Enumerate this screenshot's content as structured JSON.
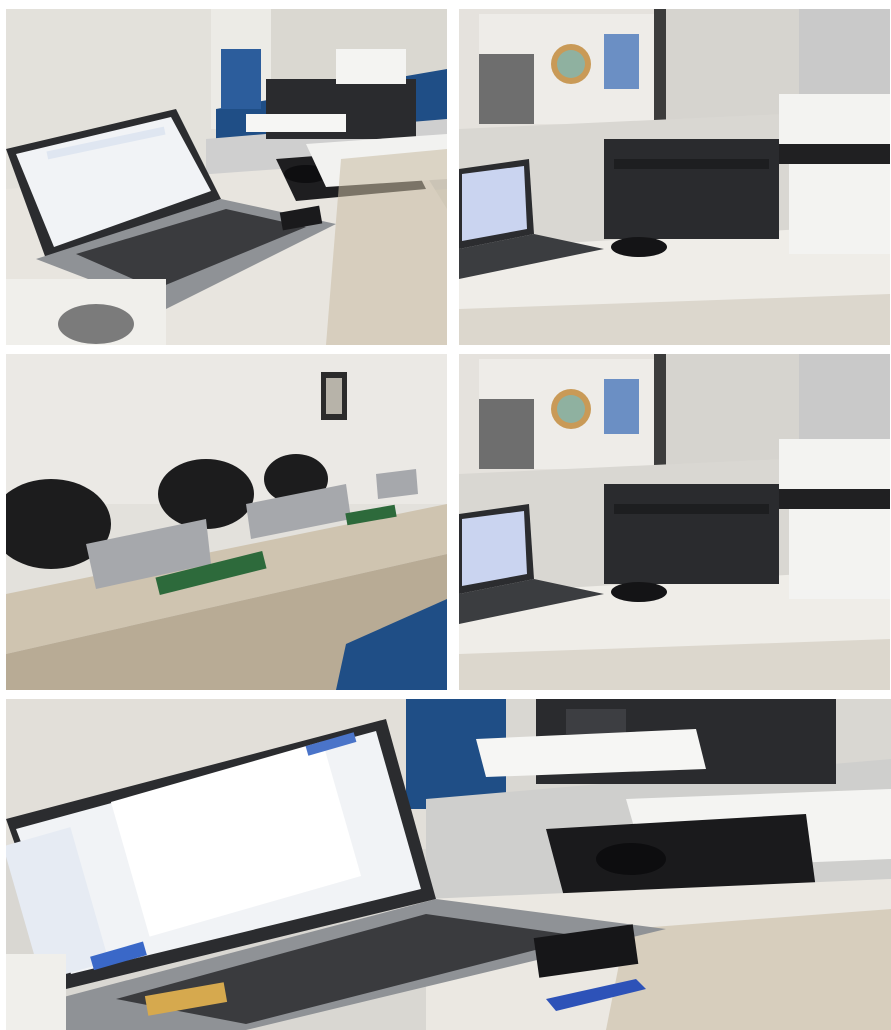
{
  "photos": [
    {
      "subject": "laptop-and-inkjet-printer-desk"
    },
    {
      "subject": "laptop-and-laser-printers-counter"
    },
    {
      "subject": "meeting-room-desk-with-laptops"
    },
    {
      "subject": "laptop-and-laser-printers-counter"
    },
    {
      "subject": "laptop-closeup-with-printer"
    }
  ],
  "colors": {
    "wall": "#dcdad4",
    "desk": "#e6e3dc",
    "laptop_body": "#8f9296",
    "screen": "#f1f3f6",
    "printer": "#2a2b2e",
    "floor_blue": "#1f4e86",
    "wood": "#b8ab95"
  }
}
